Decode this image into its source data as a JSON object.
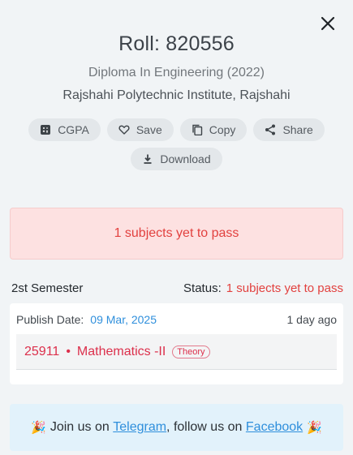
{
  "header": {
    "roll": "Roll: 820556",
    "program": "Diploma In Engineering (2022)",
    "institute": "Rajshahi Polytechnic Institute, Rajshahi"
  },
  "actions": [
    {
      "label": "CGPA",
      "icon": "calculator-icon"
    },
    {
      "label": "Save",
      "icon": "heart-icon"
    },
    {
      "label": "Copy",
      "icon": "copy-icon"
    },
    {
      "label": "Share",
      "icon": "share-icon"
    },
    {
      "label": "Download",
      "icon": "download-icon"
    }
  ],
  "alert": {
    "text": "1 subjects yet to pass"
  },
  "semester": {
    "title": "2st Semester",
    "status_label": "Status:",
    "status_value": "1 subjects yet to pass",
    "publish_label": "Publish Date:",
    "publish_date": "09 Mar, 2025",
    "ago": "1 day ago",
    "subject": {
      "code": "25911",
      "separator": "•",
      "name": "Mathematics -II",
      "type": "Theory"
    }
  },
  "banner": {
    "prefix": "Join us on",
    "telegram": "Telegram",
    "middle": ", follow us on",
    "facebook": "Facebook",
    "emoji": "🎉"
  },
  "colors": {
    "accent_blue": "#2f8fdc",
    "danger": "#e2413f",
    "alert_bg": "#fde1e1"
  }
}
